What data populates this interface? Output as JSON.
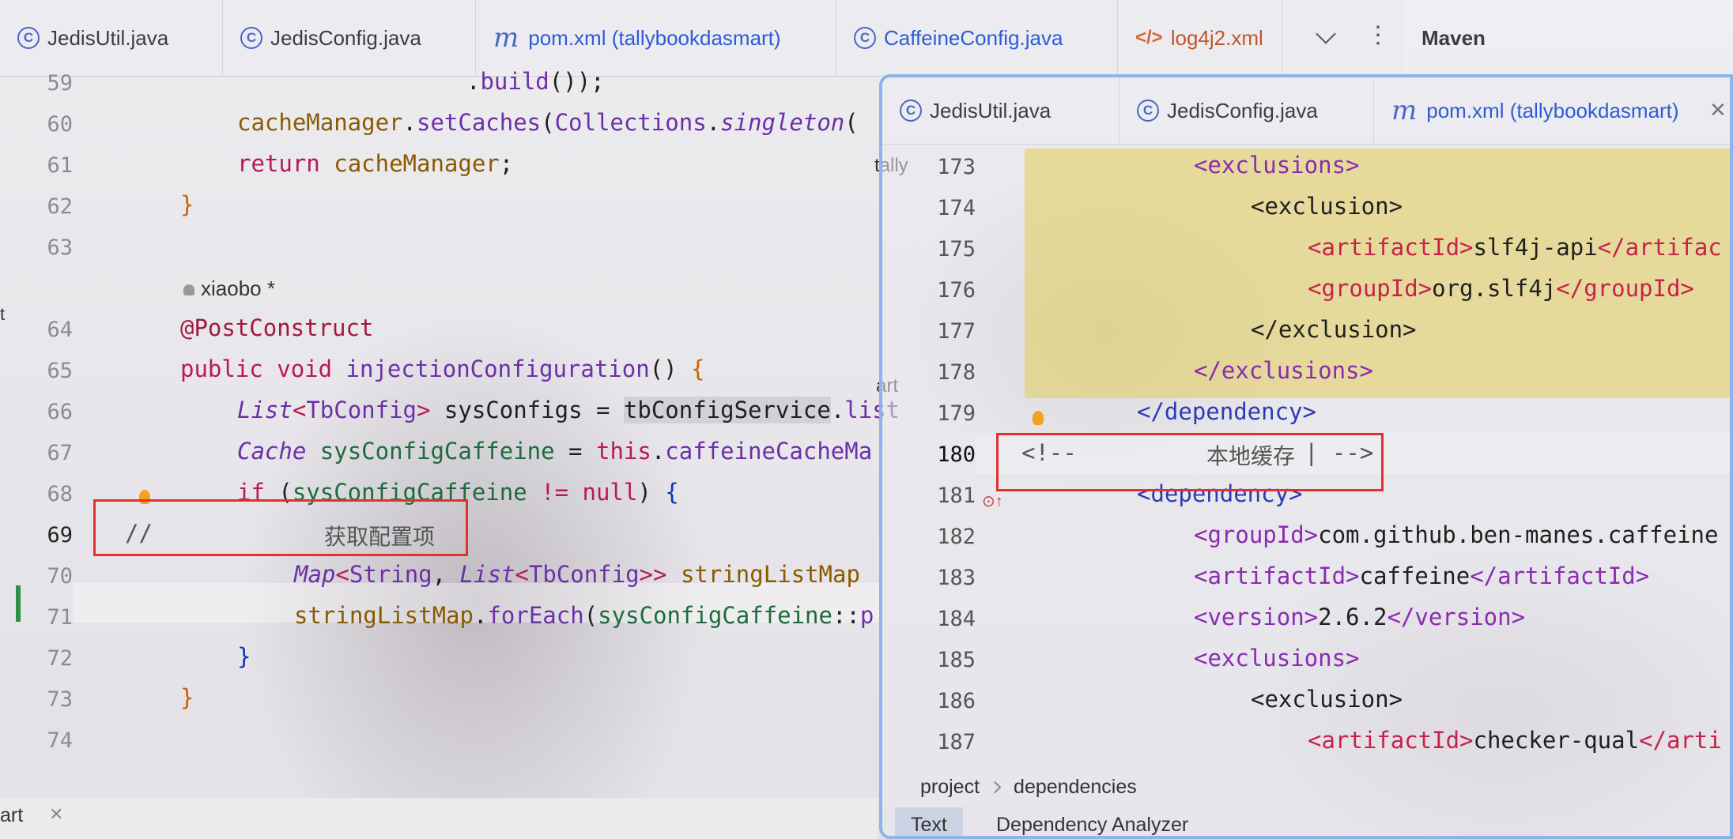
{
  "main_tabs": [
    {
      "label": "JedisUtil.java",
      "icon": "class-icon"
    },
    {
      "label": "JedisConfig.java",
      "icon": "class-icon"
    },
    {
      "label": "pom.xml (tallybookdasmart)",
      "icon": "maven-icon"
    },
    {
      "label": "CaffeineConfig.java",
      "icon": "class-icon"
    },
    {
      "label": "log4j2.xml",
      "icon": "xml-icon"
    }
  ],
  "tool_window_title": "Maven",
  "editor1": {
    "line_numbers": [
      "59",
      "60",
      "61",
      "62",
      "63",
      "64",
      "65",
      "66",
      "67",
      "68",
      "69",
      "70",
      "71",
      "72",
      "73",
      "74"
    ],
    "author": "xiaobo *",
    "comment_text": "获取配置项",
    "comment_prefix": "//"
  },
  "floating": {
    "tabs": [
      {
        "label": "JedisUtil.java",
        "icon": "class-icon"
      },
      {
        "label": "JedisConfig.java",
        "icon": "class-icon"
      },
      {
        "label": "pom.xml (tallybookdasmart)",
        "icon": "maven-icon"
      }
    ],
    "line_numbers": [
      "173",
      "174",
      "175",
      "176",
      "177",
      "178",
      "179",
      "180",
      "181",
      "182",
      "183",
      "184",
      "185",
      "186",
      "187"
    ],
    "comment_text": "本地缓存",
    "breadcrumb": [
      "project",
      "dependencies"
    ],
    "bottom_tabs": [
      "Text",
      "Dependency Analyzer"
    ]
  },
  "bottom_panel_label": "art",
  "side_fragments": {
    "tally": "tally",
    "art": "art",
    "t": "t"
  },
  "colors": {
    "accent": "#2e5bd8",
    "highlight_box": "#e53030",
    "selection_yellow": "#e2cd58"
  }
}
